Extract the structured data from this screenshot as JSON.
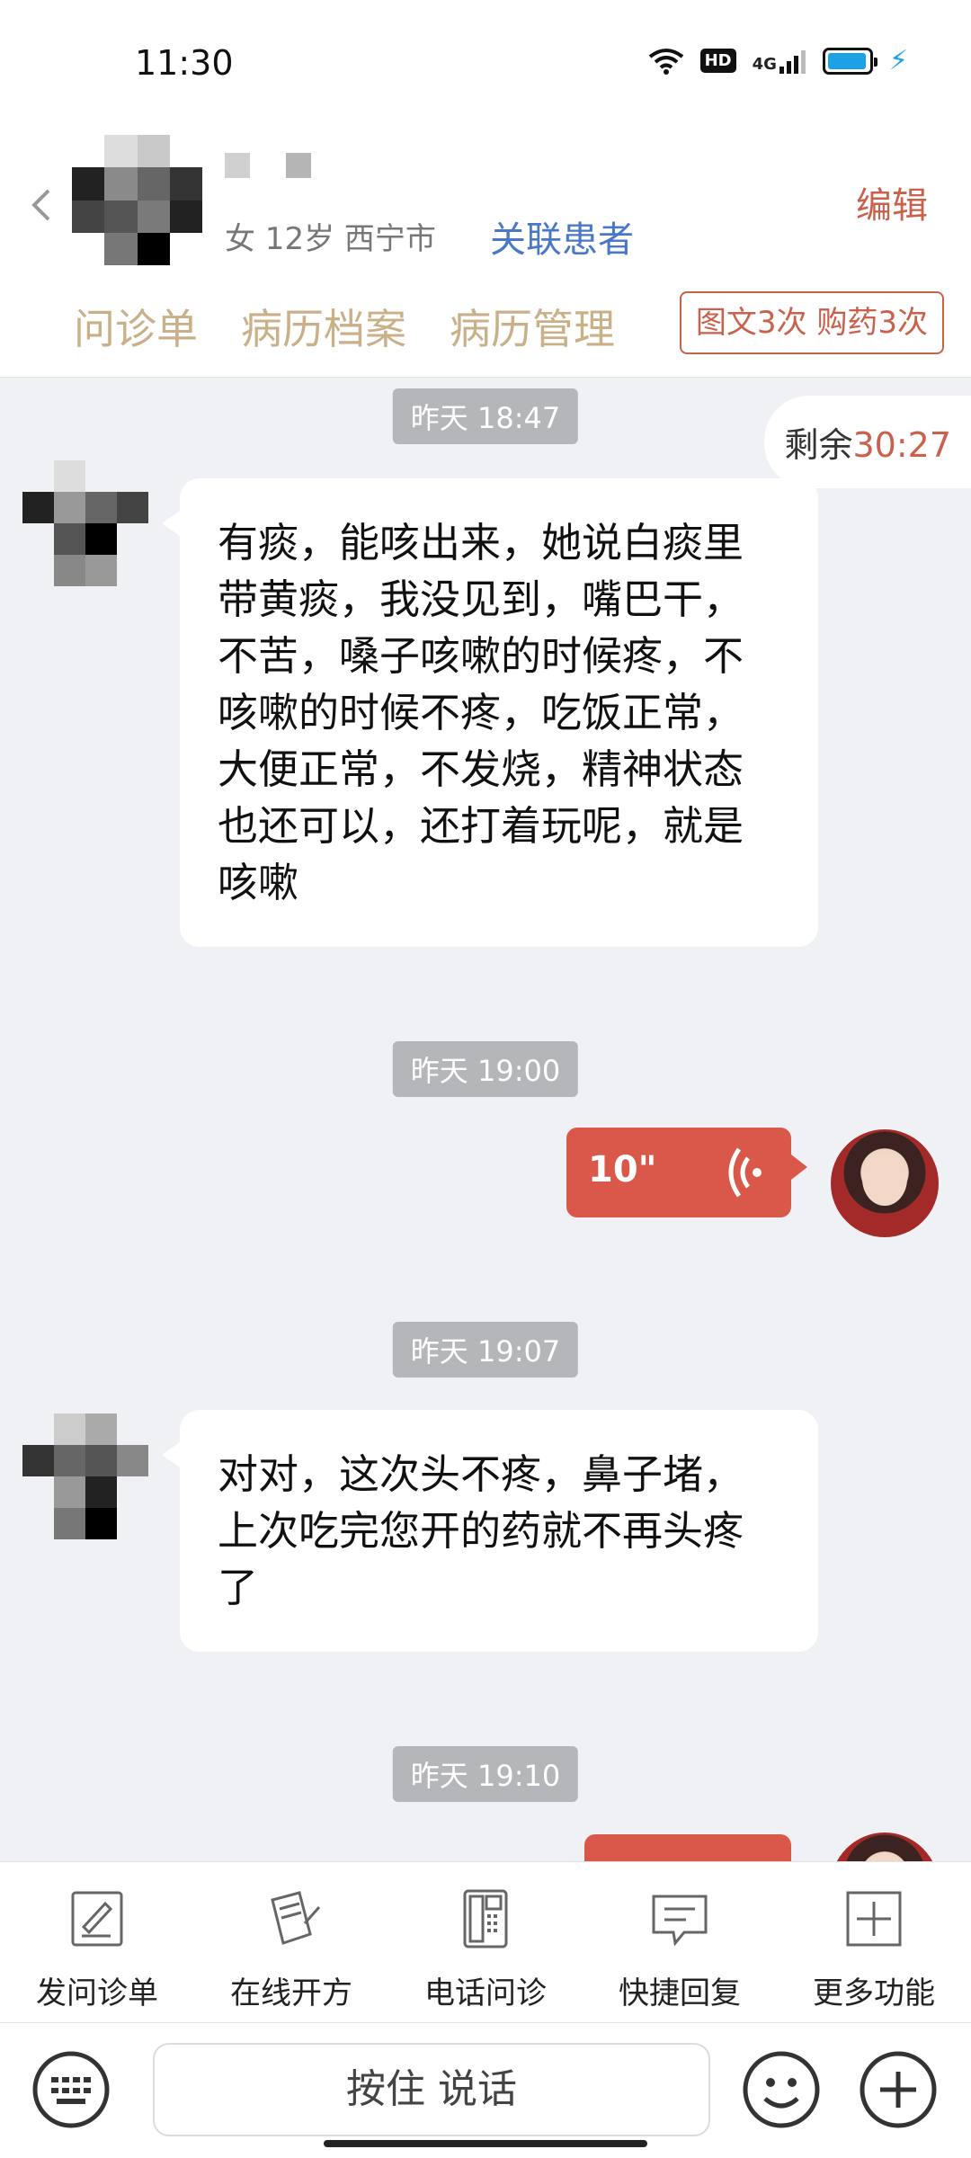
{
  "status_bar": {
    "time": "11:30",
    "hd": "HD",
    "network": "4G"
  },
  "header": {
    "patient_info": "女 12岁  西宁市",
    "link_patient": "关联患者",
    "edit": "编辑",
    "tabs": [
      "问诊单",
      "病历档案",
      "病历管理"
    ],
    "quota": "图文3次 购药3次"
  },
  "chat": {
    "remaining_label": "剩余",
    "remaining_time": "30:27",
    "messages": [
      {
        "time": "昨天 18:47",
        "type": "patient_text",
        "text": "有痰，能咳出来，她说白痰里带黄痰，我没见到，嘴巴干，不苦，嗓子咳嗽的时候疼，不咳嗽的时候不疼，吃饭正常，大便正常，不发烧，精神状态也还可以，还打着玩呢，就是咳嗽"
      },
      {
        "time": "昨天 19:00",
        "type": "doctor_voice",
        "duration": "10\""
      },
      {
        "time": "昨天 19:07",
        "type": "patient_text",
        "text": "对对，这次头不疼，鼻子堵，上次吃完您开的药就不再头疼了"
      },
      {
        "time": "昨天 19:10",
        "type": "doctor_voice",
        "duration": ""
      }
    ]
  },
  "toolbar": {
    "items": [
      "发问诊单",
      "在线开方",
      "电话问诊",
      "快捷回复",
      "更多功能"
    ]
  },
  "input": {
    "push_to_talk": "按住 说话"
  },
  "colors": {
    "accent": "#c9614d",
    "voice_bubble": "#d9584a",
    "link": "#4a78c8",
    "tab": "#c9b088"
  }
}
